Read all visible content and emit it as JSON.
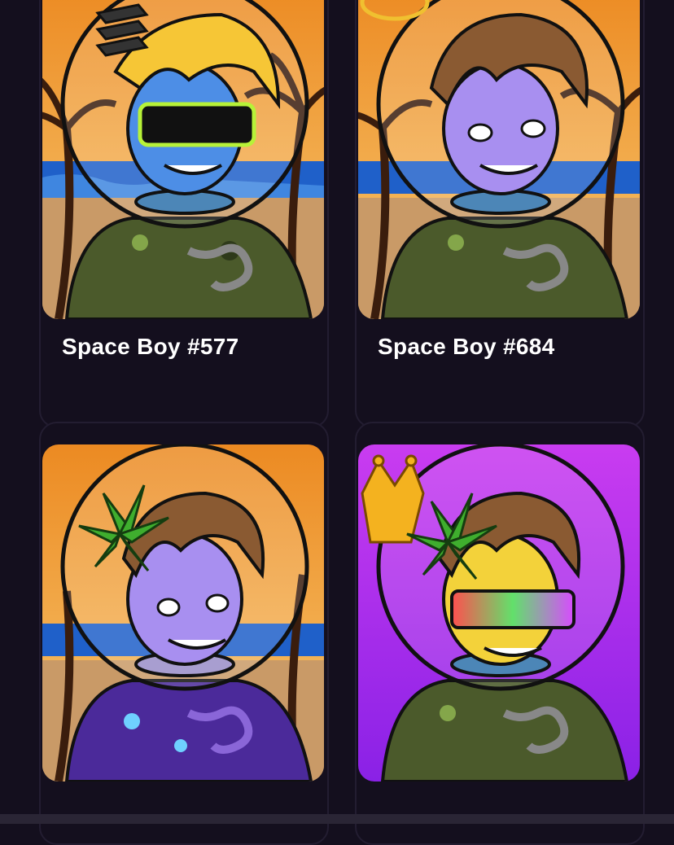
{
  "cards": [
    {
      "title": "Space Boy #577",
      "variant": "blue-skin-visor",
      "background": "beach-sunset"
    },
    {
      "title": "Space Boy #684",
      "variant": "purple-skin-halo",
      "background": "beach-sunset"
    },
    {
      "title": "",
      "variant": "purple-skin-leaf",
      "background": "beach-sunset"
    },
    {
      "title": "",
      "variant": "yellow-skin-crown",
      "background": "purple-gradient"
    }
  ],
  "colors": {
    "page_bg": "#140f1e",
    "card_border": "#231d31",
    "sunset_top": "#f29b2e",
    "sunset_bottom": "#f7c165",
    "ocean": "#1f60c9",
    "sand": "#c99a67",
    "purple_bg_top": "#c93cf0",
    "purple_bg_bottom": "#8a21e6",
    "suit_green": "#4a5a2a"
  }
}
